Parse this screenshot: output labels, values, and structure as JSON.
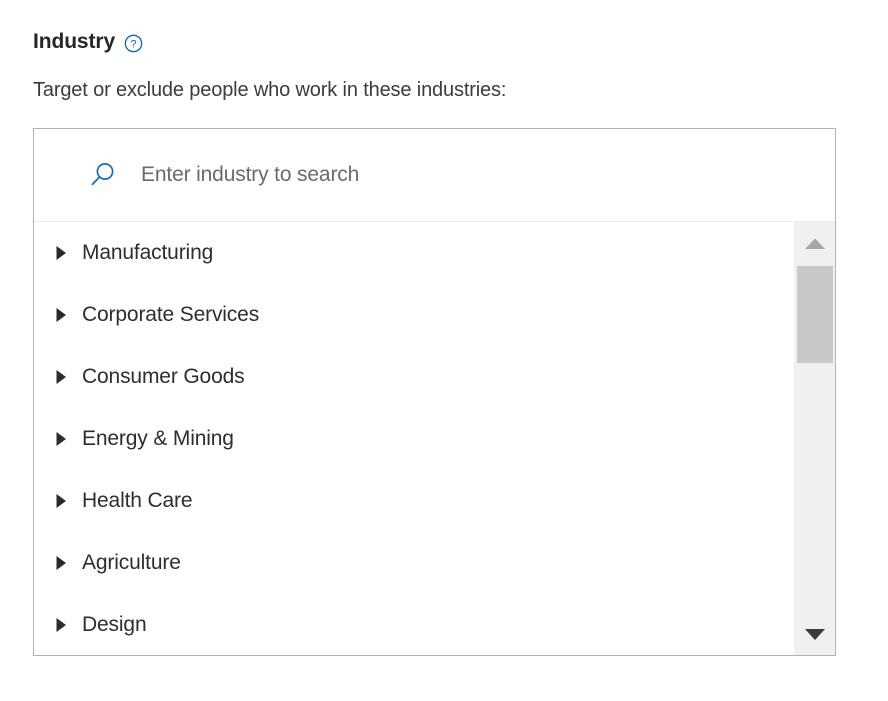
{
  "section": {
    "title": "Industry",
    "help_icon": "question-circle-icon",
    "help_icon_color": "#0a66c2",
    "description": "Target or exclude people who work in these industries:"
  },
  "search": {
    "icon": "search-icon",
    "icon_color": "#1a6dad",
    "value": "",
    "placeholder": "Enter industry to search"
  },
  "list": {
    "expand_icon": "triangle-right-icon",
    "items": [
      {
        "label": "Manufacturing",
        "expanded": false
      },
      {
        "label": "Corporate Services",
        "expanded": false
      },
      {
        "label": "Consumer Goods",
        "expanded": false
      },
      {
        "label": "Energy & Mining",
        "expanded": false
      },
      {
        "label": "Health Care",
        "expanded": false
      },
      {
        "label": "Agriculture",
        "expanded": false
      },
      {
        "label": "Design",
        "expanded": false
      }
    ]
  },
  "scrollbar": {
    "up_icon": "triangle-up-icon",
    "down_icon": "triangle-down-icon",
    "up_icon_color": "#a6a6a6",
    "down_icon_color": "#3a3a3a",
    "thumb_color": "#c8c8c8",
    "track_color": "#f0f0f0"
  },
  "colors": {
    "accent": "#0a66c2",
    "border": "#b3b3b3",
    "text": "#2e2e2e",
    "muted_text": "#6b6b6b",
    "background": "#ffffff"
  }
}
